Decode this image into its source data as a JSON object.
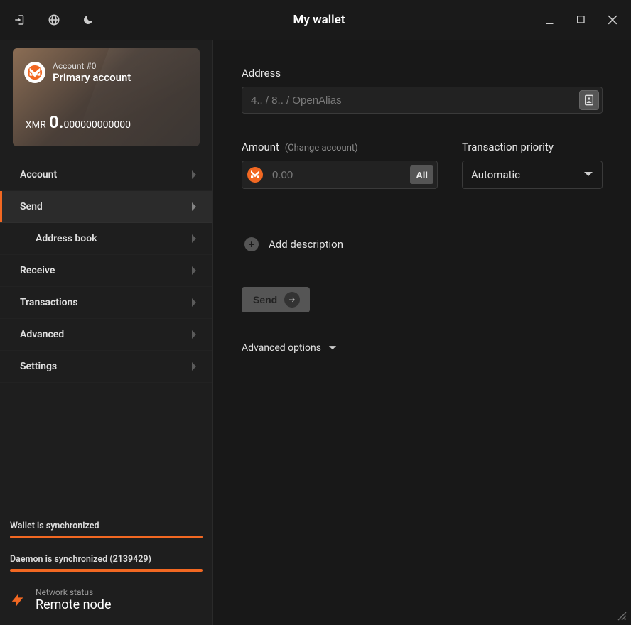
{
  "titlebar": {
    "title": "My wallet"
  },
  "account": {
    "number_label": "Account #0",
    "name": "Primary account",
    "currency": "XMR",
    "balance_int": "0.",
    "balance_frac": "000000000000"
  },
  "nav": {
    "items": [
      {
        "label": "Account"
      },
      {
        "label": "Send"
      },
      {
        "label": "Address book"
      },
      {
        "label": "Receive"
      },
      {
        "label": "Transactions"
      },
      {
        "label": "Advanced"
      },
      {
        "label": "Settings"
      }
    ]
  },
  "sync": {
    "wallet_label": "Wallet is synchronized",
    "daemon_label": "Daemon is synchronized (2139429)"
  },
  "network": {
    "title": "Network status",
    "value": "Remote node"
  },
  "send": {
    "address_label": "Address",
    "address_placeholder": "4.. / 8.. / OpenAlias",
    "amount_label": "Amount",
    "change_account": "(Change account)",
    "amount_placeholder": "0.00",
    "all_btn": "All",
    "priority_label": "Transaction priority",
    "priority_value": "Automatic",
    "add_description": "Add description",
    "send_btn": "Send",
    "advanced_options": "Advanced options"
  }
}
